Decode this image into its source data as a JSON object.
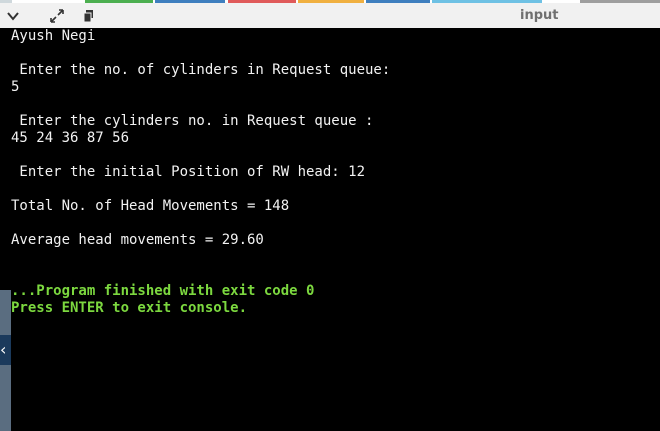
{
  "toolbar": {
    "input_label": "input",
    "buttons": [
      {
        "icon": "chevron-down-icon"
      },
      {
        "icon": "expand-icon"
      },
      {
        "icon": "copy-icon"
      }
    ]
  },
  "console": {
    "user": "Ayush Negi",
    "prompt_count": " Enter the no. of cylinders in Request queue:",
    "value_count": "5",
    "prompt_cylinders": " Enter the cylinders no. in Request queue :",
    "value_cylinders": "45 24 36 87 56",
    "prompt_head": " Enter the initial Position of RW head: 12",
    "total_movements": "Total No. of Head Movements = 148",
    "average_movements": "Average head movements = 29.60",
    "exit_message": "...Program finished with exit code 0",
    "exit_prompt": "Press ENTER to exit console."
  },
  "sidebar": {
    "collapse_glyph": "‹"
  },
  "colors": {
    "console_bg": "#000000",
    "console_text": "#f2f2f2",
    "exit_text": "#7cd83f",
    "toolbar_bg": "#f1f1f1",
    "sidebar": "#5a6d80"
  }
}
